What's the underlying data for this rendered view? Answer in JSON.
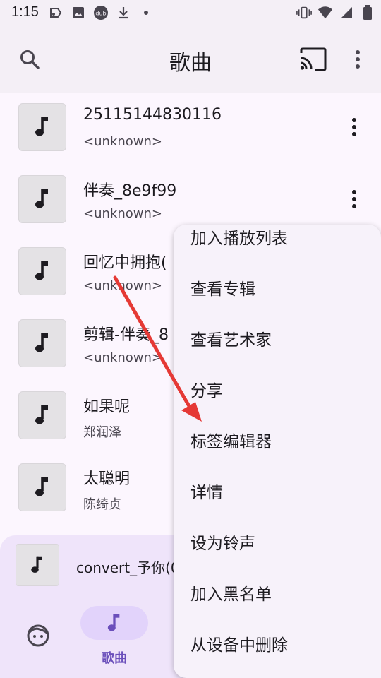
{
  "status_bar": {
    "time": "1:15",
    "left_icons": [
      "tv-icon",
      "image-icon",
      "dub-icon",
      "download-icon",
      "dot-icon"
    ],
    "dub_label": "dub",
    "right_icons": [
      "vibrate-icon",
      "wifi-icon",
      "signal-icon",
      "battery-icon"
    ]
  },
  "app_bar": {
    "title": "歌曲",
    "icons": [
      "search-icon",
      "cast-icon",
      "more-vert-icon"
    ]
  },
  "songs": [
    {
      "title": "25115144830116",
      "artist": "<unknown>",
      "has_more": true
    },
    {
      "title": "伴奏_8e9f99",
      "artist": "<unknown>",
      "has_more": true
    },
    {
      "title": "回忆中拥抱(",
      "artist": "<unknown>",
      "has_more": false
    },
    {
      "title": "剪辑-伴奏_8",
      "artist": "<unknown>",
      "has_more": false
    },
    {
      "title": "如果呢",
      "artist": "郑润泽",
      "has_more": false
    },
    {
      "title": "太聪明",
      "artist": "陈绮贞",
      "has_more": false
    }
  ],
  "mini_player": {
    "title": "convert_予你(0"
  },
  "bottom_nav": {
    "items": [
      {
        "icon": "face-icon",
        "label": ""
      },
      {
        "icon": "music-note-icon",
        "label": "歌曲",
        "selected": true
      }
    ]
  },
  "context_menu": {
    "items": [
      "加入播放列表",
      "查看专辑",
      "查看艺术家",
      "分享",
      "标签编辑器",
      "详情",
      "设为铃声",
      "加入黑名单",
      "从设备中删除"
    ]
  },
  "colors": {
    "accent": "#6b4fbb",
    "annotation_arrow": "#e53935",
    "surface": "#fcf6fe",
    "menu_surface": "#f7f2fa"
  }
}
